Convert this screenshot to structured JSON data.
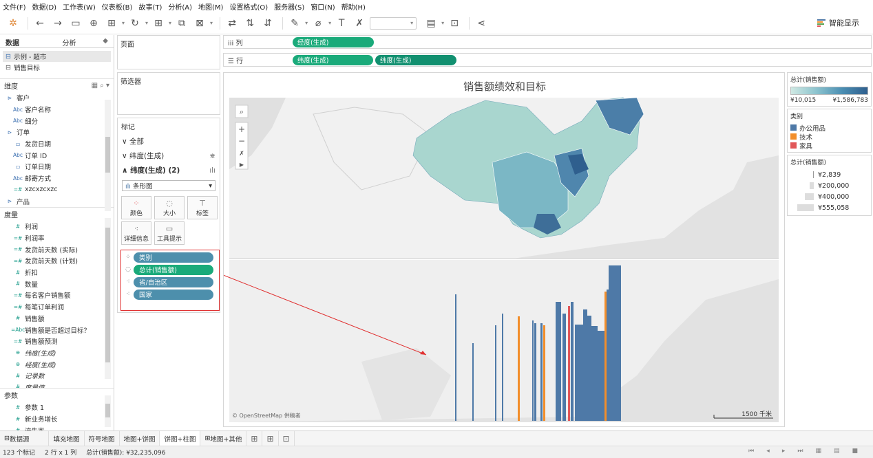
{
  "menu": [
    "文件(F)",
    "数据(D)",
    "工作表(W)",
    "仪表板(B)",
    "故事(T)",
    "分析(A)",
    "地图(M)",
    "设置格式(O)",
    "服务器(S)",
    "窗口(N)",
    "帮助(H)"
  ],
  "toolbar": {
    "smart_label": "智能显示"
  },
  "data_pane": {
    "tab_data": "数据",
    "tab_analysis": "分析",
    "datasources": [
      "示例 - 超市",
      "销售目标"
    ],
    "dimensions_title": "维度",
    "dimensions": [
      {
        "type": "folder",
        "name": "客户"
      },
      {
        "type": "Abc",
        "name": "客户名称"
      },
      {
        "type": "Abc",
        "name": "细分"
      },
      {
        "type": "folder",
        "name": "订单"
      },
      {
        "type": "date",
        "name": "发货日期"
      },
      {
        "type": "Abc",
        "name": "订单 ID"
      },
      {
        "type": "date",
        "name": "订单日期"
      },
      {
        "type": "Abc",
        "name": "邮寄方式"
      },
      {
        "type": "=#",
        "name": "xzcxzcxzc"
      },
      {
        "type": "folder",
        "name": "产品"
      }
    ],
    "measures_title": "度量",
    "measures": [
      {
        "type": "#",
        "name": "利润"
      },
      {
        "type": "=#",
        "name": "利润率"
      },
      {
        "type": "=#",
        "name": "发货前天数 (实际)"
      },
      {
        "type": "=#",
        "name": "发货前天数 (计划)"
      },
      {
        "type": "#",
        "name": "折扣"
      },
      {
        "type": "#",
        "name": "数量"
      },
      {
        "type": "=#",
        "name": "每名客户销售额"
      },
      {
        "type": "=#",
        "name": "每笔订单利润"
      },
      {
        "type": "#",
        "name": "销售额"
      },
      {
        "type": "=Abc",
        "name": "销售额是否超过目标？"
      },
      {
        "type": "=#",
        "name": "销售额预测"
      },
      {
        "type": "geo",
        "name": "纬度(生成)",
        "italic": true
      },
      {
        "type": "geo",
        "name": "经度(生成)",
        "italic": true
      },
      {
        "type": "#",
        "name": "记录数",
        "italic": true
      },
      {
        "type": "#",
        "name": "度量值",
        "italic": true
      }
    ],
    "params_title": "参数",
    "params": [
      {
        "type": "#",
        "name": "参数 1"
      },
      {
        "type": "#",
        "name": "新业务增长"
      },
      {
        "type": "#",
        "name": "流失率"
      }
    ]
  },
  "pages_title": "页面",
  "filters_title": "筛选器",
  "marks": {
    "title": "标记",
    "all": "全部",
    "lat1": "纬度(生成)",
    "lat2": "纬度(生成) (2)",
    "mark_type": "条形图",
    "btn_color": "颜色",
    "btn_size": "大小",
    "btn_label": "标签",
    "btn_detail": "详细信息",
    "btn_tooltip": "工具提示",
    "pills": [
      {
        "label": "类别",
        "color": "#4d8fac"
      },
      {
        "label": "总计(销售额)",
        "color": "#1aaa7a"
      },
      {
        "label": "省/自治区",
        "color": "#4d8fac"
      },
      {
        "label": "国家",
        "color": "#4d8fac"
      }
    ]
  },
  "shelves": {
    "columns_label": "列",
    "rows_label": "行",
    "columns_pills": [
      "经度(生成)"
    ],
    "rows_pills": [
      "纬度(生成)",
      "纬度(生成)"
    ]
  },
  "view": {
    "title": "销售额绩效和目标",
    "attribution": "© OpenStreetMap 供稿者",
    "scale": "1500 千米"
  },
  "legends": {
    "color_title": "总计(销售额)",
    "color_min": "¥10,015",
    "color_max": "¥1,586,783",
    "category_title": "类别",
    "categories": [
      {
        "label": "办公用品",
        "color": "#4e79a7"
      },
      {
        "label": "技术",
        "color": "#f28e2b"
      },
      {
        "label": "家具",
        "color": "#e15759"
      }
    ],
    "size_title": "总计(销售额)",
    "sizes": [
      "¥2,839",
      "¥200,000",
      "¥400,000",
      "¥555,058"
    ]
  },
  "sheet_tabs": [
    "数据源",
    "填充地图",
    "符号地图",
    "地图+饼图",
    "饼图+柱图",
    "地图+其他"
  ],
  "active_tab": "饼图+柱图",
  "status": {
    "marks": "123 个标记",
    "grid": "2 行 x 1 列",
    "sum": "总计(销售额): ¥32,235,096"
  }
}
